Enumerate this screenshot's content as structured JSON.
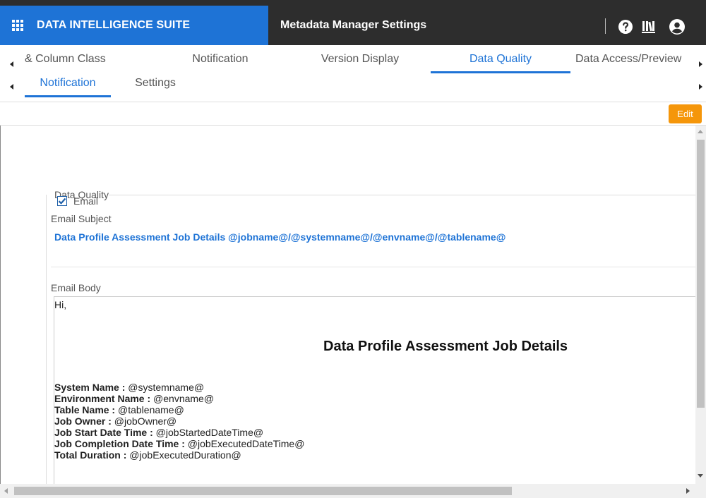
{
  "header": {
    "brand": "DATA INTELLIGENCE SUITE",
    "page_title": "Metadata Manager Settings",
    "icons": [
      "grid-apps-icon",
      "help-icon",
      "library-icon",
      "user-icon"
    ],
    "brand_color": "#1e73d6",
    "bar_color": "#2d2d2d"
  },
  "tabs": [
    {
      "label": "& Column Class",
      "active": false
    },
    {
      "label": "Notification",
      "active": false
    },
    {
      "label": "Version Display",
      "active": false
    },
    {
      "label": "Data Quality",
      "active": true
    },
    {
      "label": "Data Access/Preview",
      "active": false
    }
  ],
  "subtabs": [
    {
      "label": "Notification",
      "active": true
    },
    {
      "label": "Settings",
      "active": false
    }
  ],
  "toolbar": {
    "edit_label": "Edit",
    "edit_color": "#f5960a"
  },
  "form": {
    "section_title": "Data Quality",
    "email_checkbox_label": "Email",
    "email_checked": true,
    "email_subject_label": "Email Subject",
    "email_subject_value": "Data Profile Assessment Job Details @jobname@/@systemname@/@envname@/@tablename@",
    "email_body_label": "Email Body",
    "body": {
      "greeting": "Hi,",
      "heading": "Data Profile Assessment Job Details",
      "details": [
        {
          "label": "System Name :",
          "value": "@systemname@"
        },
        {
          "label": "Environment Name :",
          "value": "@envname@"
        },
        {
          "label": "Table Name :",
          "value": "@tablename@"
        },
        {
          "label": "Job Owner :",
          "value": "@jobOwner@"
        },
        {
          "label": "Job Start Date Time :",
          "value": "@jobStartedDateTime@"
        },
        {
          "label": "Job Completion Date Time :",
          "value": "@jobExecutedDateTime@"
        },
        {
          "label": "Total Duration :",
          "value": "@jobExecutedDuration@"
        }
      ]
    }
  }
}
